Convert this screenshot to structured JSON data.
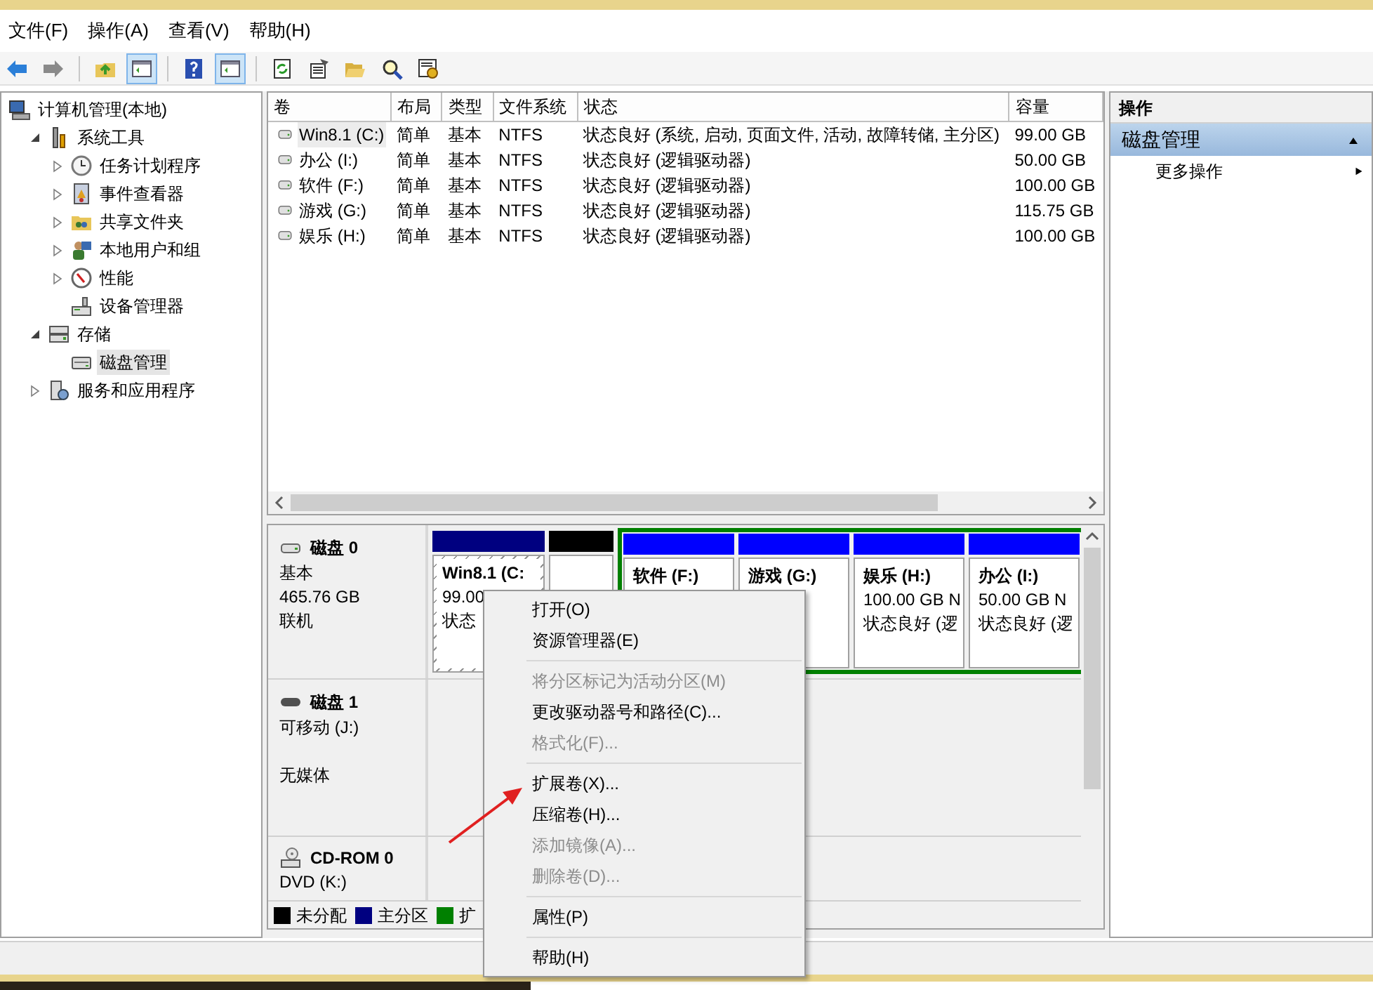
{
  "menu_bar": [
    {
      "label": "文件(F)"
    },
    {
      "label": "操作(A)"
    },
    {
      "label": "查看(V)"
    },
    {
      "label": "帮助(H)"
    }
  ],
  "toolbar": [
    {
      "kind": "back",
      "selected": false
    },
    {
      "kind": "forward",
      "selected": false
    },
    {
      "kind": "sep"
    },
    {
      "kind": "up",
      "selected": false
    },
    {
      "kind": "pane",
      "selected": true
    },
    {
      "kind": "sep"
    },
    {
      "kind": "help",
      "selected": false
    },
    {
      "kind": "pane",
      "selected": true
    },
    {
      "kind": "sep"
    },
    {
      "kind": "refresh",
      "selected": false
    },
    {
      "kind": "props",
      "selected": false
    },
    {
      "kind": "folder",
      "selected": false
    },
    {
      "kind": "search",
      "selected": false
    },
    {
      "kind": "settings",
      "selected": false
    }
  ],
  "tree": [
    {
      "label": "计算机管理(本地)",
      "kind": "computer",
      "selected": false,
      "children": [
        {
          "label": "系统工具",
          "kind": "tools",
          "expanded": true,
          "selected": false,
          "children": [
            {
              "label": "任务计划程序",
              "kind": "clock",
              "expanded": false,
              "selected": false
            },
            {
              "label": "事件查看器",
              "kind": "book",
              "expanded": false,
              "selected": false
            },
            {
              "label": "共享文件夹",
              "kind": "share",
              "expanded": false,
              "selected": false
            },
            {
              "label": "本地用户和组",
              "kind": "users",
              "expanded": false,
              "selected": false
            },
            {
              "label": "性能",
              "kind": "gauge",
              "expanded": false,
              "selected": false
            },
            {
              "label": "设备管理器",
              "kind": "device",
              "selected": false
            }
          ]
        },
        {
          "label": "存储",
          "kind": "storage",
          "expanded": true,
          "selected": false,
          "children": [
            {
              "label": "磁盘管理",
              "kind": "disk",
              "selected": true
            }
          ]
        },
        {
          "label": "服务和应用程序",
          "kind": "services",
          "expanded": false,
          "selected": false
        }
      ]
    }
  ],
  "volumes": {
    "columns": [
      "卷",
      "布局",
      "类型",
      "文件系统",
      "状态",
      "容量"
    ],
    "rows": [
      {
        "selected": true,
        "cells": [
          "Win8.1 (C:)",
          "简单",
          "基本",
          "NTFS",
          "状态良好 (系统, 启动, 页面文件, 活动, 故障转储, 主分区)",
          "99.00 GB"
        ]
      },
      {
        "selected": false,
        "cells": [
          "办公 (I:)",
          "简单",
          "基本",
          "NTFS",
          "状态良好 (逻辑驱动器)",
          "50.00 GB"
        ]
      },
      {
        "selected": false,
        "cells": [
          "软件 (F:)",
          "简单",
          "基本",
          "NTFS",
          "状态良好 (逻辑驱动器)",
          "100.00 GB"
        ]
      },
      {
        "selected": false,
        "cells": [
          "游戏 (G:)",
          "简单",
          "基本",
          "NTFS",
          "状态良好 (逻辑驱动器)",
          "115.75 GB"
        ]
      },
      {
        "selected": false,
        "cells": [
          "娱乐 (H:)",
          "简单",
          "基本",
          "NTFS",
          "状态良好 (逻辑驱动器)",
          "100.00 GB"
        ]
      }
    ]
  },
  "disks": [
    {
      "name": "磁盘 0",
      "kind": "hdd",
      "line_1": "基本",
      "line_2": "465.76 GB",
      "line_3": "联机",
      "partitions": [
        {
          "kind": "primary",
          "selected": true,
          "lines": [
            "Win8.1  (C:",
            "99.00",
            "状态"
          ]
        },
        {
          "kind": "unallocated",
          "selected": false
        },
        {
          "kind": "extended",
          "children": [
            {
              "kind": "logical",
              "selected": false,
              "lines": [
                "软件  (F:)"
              ]
            },
            {
              "kind": "logical",
              "selected": false,
              "lines": [
                "游戏  (G:)"
              ]
            },
            {
              "kind": "logical",
              "selected": false,
              "lines": [
                "娱乐  (H:)",
                "100.00 GB N",
                "状态良好 (逻"
              ]
            },
            {
              "kind": "logical",
              "selected": false,
              "lines": [
                "办公  (I:)",
                "50.00 GB N",
                "状态良好 (逻"
              ]
            }
          ]
        }
      ]
    },
    {
      "name": "磁盘 1",
      "kind": "removable",
      "line_1": "可移动 (J:)",
      "line_3": "无媒体"
    },
    {
      "name": "CD-ROM 0",
      "kind": "cdrom",
      "line_1": "DVD (K:)"
    }
  ],
  "legend": [
    {
      "label": "未分配",
      "color": "#000000"
    },
    {
      "label": "主分区",
      "color": "#000080"
    },
    {
      "label": "扩",
      "color": "#008000"
    }
  ],
  "actions": {
    "title": "操作",
    "sections": [
      {
        "label": "磁盘管理",
        "expanded": true,
        "items": [
          {
            "label": "更多操作"
          }
        ]
      }
    ]
  },
  "context_menu": [
    {
      "kind": "item",
      "label": "打开(O)",
      "disabled": false
    },
    {
      "kind": "item",
      "label": "资源管理器(E)",
      "disabled": false
    },
    {
      "kind": "separator"
    },
    {
      "kind": "item",
      "label": "将分区标记为活动分区(M)",
      "disabled": true
    },
    {
      "kind": "item",
      "label": "更改驱动器号和路径(C)...",
      "disabled": false
    },
    {
      "kind": "item",
      "label": "格式化(F)...",
      "disabled": true
    },
    {
      "kind": "separator"
    },
    {
      "kind": "item",
      "label": "扩展卷(X)...",
      "disabled": false
    },
    {
      "kind": "item",
      "label": "压缩卷(H)...",
      "disabled": false
    },
    {
      "kind": "item",
      "label": "添加镜像(A)...",
      "disabled": true
    },
    {
      "kind": "item",
      "label": "删除卷(D)...",
      "disabled": true
    },
    {
      "kind": "separator"
    },
    {
      "kind": "item",
      "label": "属性(P)",
      "disabled": false
    },
    {
      "kind": "separator"
    },
    {
      "kind": "item",
      "label": "帮助(H)",
      "disabled": false
    }
  ]
}
